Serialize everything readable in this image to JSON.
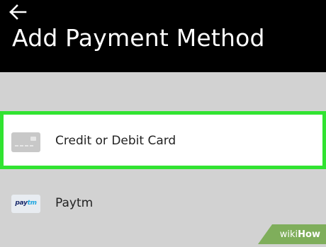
{
  "header": {
    "title": "Add Payment Method",
    "back_icon": "arrow-left-icon"
  },
  "payment_methods": [
    {
      "label": "Credit or Debit Card",
      "icon": "credit-card-icon",
      "highlighted": true
    },
    {
      "label": "Paytm",
      "icon": "paytm-logo-icon",
      "logo_text_1": "pay",
      "logo_text_2": "tm"
    }
  ],
  "watermark": {
    "part1": "wiki",
    "part2": "How"
  },
  "colors": {
    "header_bg": "#000000",
    "page_bg": "#d2d2d2",
    "highlight": "#31e331",
    "row_bg": "#ffffff"
  }
}
